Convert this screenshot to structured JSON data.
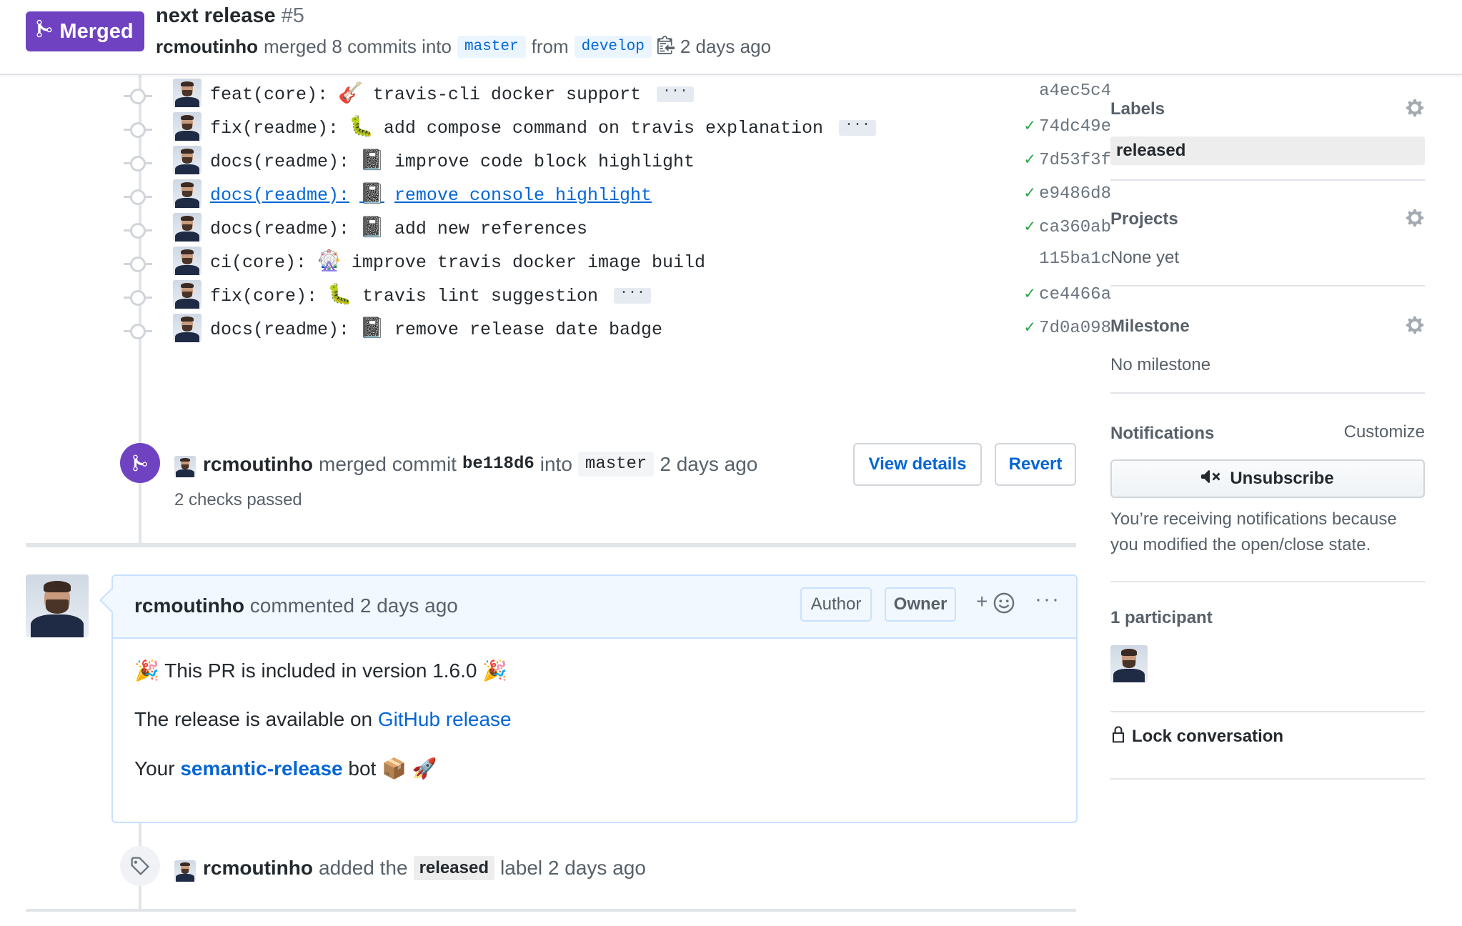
{
  "header": {
    "state": "Merged",
    "title": "next release",
    "number": "#5",
    "author": "rcmoutinho",
    "action": "merged 8 commits into",
    "base_branch": "master",
    "from_word": "from",
    "head_branch": "develop",
    "time": "2 days ago"
  },
  "commits": [
    {
      "type": "feat(core):",
      "emoji": "🎸",
      "text": "travis-cli docker support",
      "has_ellipsis": true,
      "sha": "a4ec5c4",
      "checked": false
    },
    {
      "type": "fix(readme):",
      "emoji": "🐛",
      "text": "add compose command on travis explanation",
      "has_ellipsis": true,
      "sha": "74dc49e",
      "checked": true
    },
    {
      "type": "docs(readme):",
      "emoji": "📓",
      "text": "improve code block highlight",
      "has_ellipsis": false,
      "sha": "7d53f3f",
      "checked": true
    },
    {
      "type": "docs(readme):",
      "emoji": "📓",
      "text": "remove console highlight",
      "has_ellipsis": false,
      "sha": "e9486d8",
      "checked": true,
      "hovered": true
    },
    {
      "type": "docs(readme):",
      "emoji": "📓",
      "text": "add new references",
      "has_ellipsis": false,
      "sha": "ca360ab",
      "checked": true
    },
    {
      "type": "ci(core):",
      "emoji": "🎡",
      "text": "improve travis docker image build",
      "has_ellipsis": false,
      "sha": "115ba1c",
      "checked": false
    },
    {
      "type": "fix(core):",
      "emoji": "🐛",
      "text": "travis lint suggestion",
      "has_ellipsis": true,
      "sha": "ce4466a",
      "checked": true
    },
    {
      "type": "docs(readme):",
      "emoji": "📓",
      "text": "remove release date badge",
      "has_ellipsis": false,
      "sha": "7d0a098",
      "checked": true
    }
  ],
  "ellipsis_label": "···",
  "merge_event": {
    "author": "rcmoutinho",
    "action": "merged commit",
    "sha": "be118d6",
    "into": "into",
    "branch": "master",
    "time": "2 days ago",
    "checks": "2 checks passed",
    "view_details_label": "View details",
    "revert_label": "Revert"
  },
  "comment": {
    "author": "rcmoutinho",
    "action": "commented 2 days ago",
    "author_badge": "Author",
    "owner_badge": "Owner",
    "reaction_plus": "+",
    "more_label": "···",
    "line1_emoji": "🎉",
    "line1_text": "This PR is included in version 1.6.0",
    "line2_prefix": "The release is available on",
    "line2_link": "GitHub release",
    "line3_prefix": "Your",
    "line3_link": "semantic-release",
    "line3_suffix": "bot",
    "line3_emoji1": "📦",
    "line3_emoji2": "🚀"
  },
  "label_event": {
    "author": "rcmoutinho",
    "action": "added the",
    "label": "released",
    "suffix": "label 2 days ago"
  },
  "sidebar": {
    "labels_title": "Labels",
    "labels": [
      "released"
    ],
    "projects_title": "Projects",
    "projects_value": "None yet",
    "milestone_title": "Milestone",
    "milestone_value": "No milestone",
    "notifications_title": "Notifications",
    "customize_label": "Customize",
    "unsubscribe_label": "Unsubscribe",
    "notifications_reason": "You’re receiving notifications because you modified the open/close state.",
    "participants_title": "1 participant",
    "lock_label": "Lock conversation"
  },
  "colors": {
    "merged_purple": "#6f42c1",
    "link_blue": "#0366d6",
    "success_green": "#28a745"
  }
}
